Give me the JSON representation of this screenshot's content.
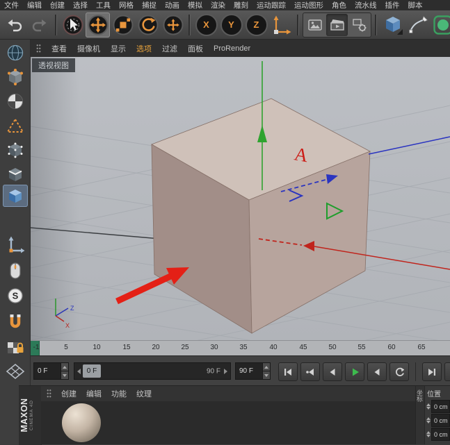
{
  "menubar": {
    "items": [
      "文件",
      "编辑",
      "创建",
      "选择",
      "工具",
      "网格",
      "捕捉",
      "动画",
      "模拟",
      "渲染",
      "雕刻",
      "运动跟踪",
      "运动图形",
      "角色",
      "流水线",
      "插件",
      "脚本"
    ]
  },
  "toolbar": {
    "axis_lock": {
      "x": "X",
      "y": "Y",
      "z": "Z"
    },
    "icons": [
      "undo",
      "redo",
      "live-selection",
      "move-tool",
      "scale-tool",
      "rotate-tool",
      "last-used-tool",
      "x-axis-lock",
      "y-axis-lock",
      "z-axis-lock",
      "coordinate-system",
      "render-view",
      "render-to-picture-viewer",
      "render-settings",
      "cube-primitive",
      "pen-spline",
      "subdivision-surface"
    ],
    "active_tool": "move-tool"
  },
  "left_palette": {
    "icons": [
      "globe",
      "make-editable",
      "texture-mode",
      "workplane-mode",
      "points-mode",
      "edges-mode",
      "polygons-mode",
      "enable-axis",
      "mouse-input",
      "snap",
      "magnet",
      "lock-workplane",
      "plane-grid"
    ],
    "selected": "polygons-mode",
    "snap_letter": "S"
  },
  "viewport_menu": {
    "items": [
      "查看",
      "摄像机",
      "显示",
      "选项",
      "过滤",
      "面板",
      "ProRender"
    ],
    "highlighted": "选项"
  },
  "viewport": {
    "label": "透视视图",
    "annotation_letter": "A",
    "mini_axis": {
      "x": "X",
      "z": "Z"
    }
  },
  "timeline": {
    "ticks": [
      "-1",
      "5",
      "10",
      "15",
      "20",
      "25",
      "30",
      "35",
      "40",
      "45",
      "50",
      "55",
      "60",
      "65"
    ],
    "current_frame": 0
  },
  "anim": {
    "start_field": "0 F",
    "end_field": "90 F",
    "slider_current": "0 F",
    "slider_end": "90 F",
    "transport_icons": [
      "goto-start",
      "goto-previous-key",
      "goto-previous-frame",
      "play-forward",
      "goto-next-frame",
      "loop",
      "goto-end",
      "record-keyframe"
    ]
  },
  "material_panel": {
    "menus": [
      "创建",
      "编辑",
      "功能",
      "纹理"
    ]
  },
  "coord_panel": {
    "tab": "坐标",
    "position_label": "位置",
    "values": [
      "0 cm",
      "0 cm",
      "0 cm"
    ]
  },
  "logo": {
    "brand": "MAXON",
    "product": "CINEMA 4D"
  },
  "colors": {
    "accent_orange": "#e8953c",
    "menu_highlight": "#e8a33c",
    "viewport_bg": "#b6b9be",
    "cube_top": "#cfc1b9",
    "cube_left": "#a28e88",
    "cube_right": "#b7a49d",
    "axis_x_red": "#c0241c",
    "axis_y_green": "#2fa32f",
    "axis_z_blue": "#2a34c0",
    "annotation_red": "#e42016",
    "play_green": "#3dbb4e",
    "frame_marker_green": "#2c7a58"
  }
}
